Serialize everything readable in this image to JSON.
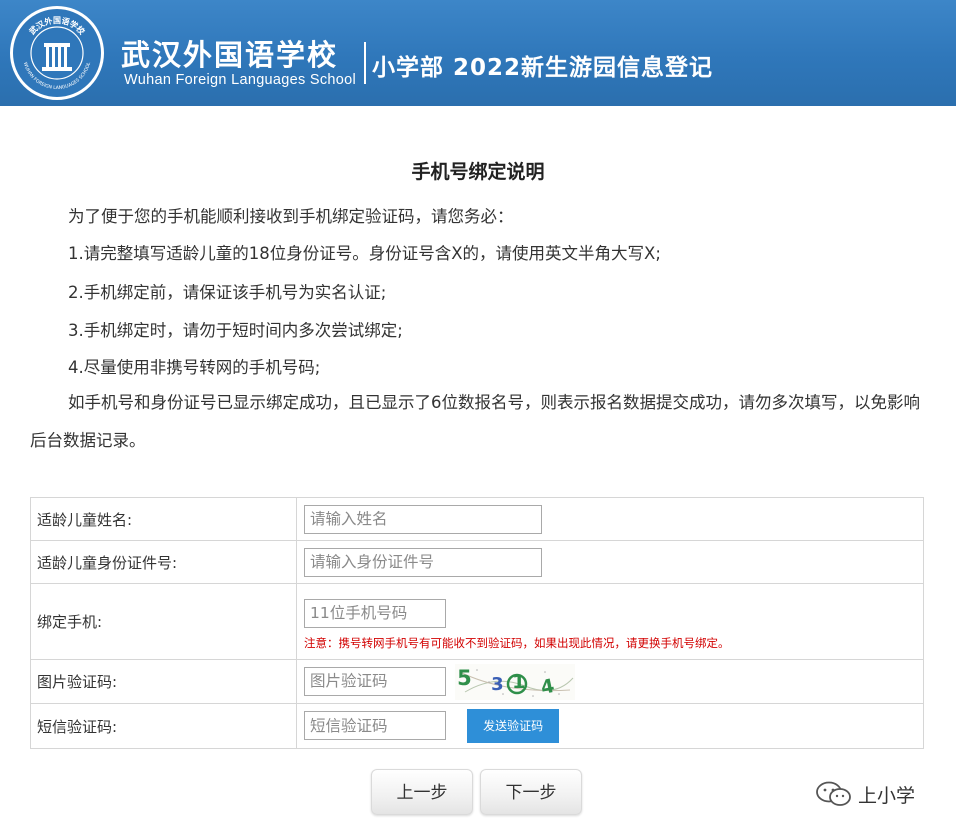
{
  "header": {
    "school_name_cn": "武汉外国语学校",
    "school_name_en": "Wuhan Foreign Languages School",
    "seal_text": "武汉外国语学校 WUHAN FOREIGN LANGUAGES SCHOOL",
    "page_title": "小学部 2022新生游园信息登记"
  },
  "notice": {
    "title": "手机号绑定说明",
    "intro": "为了便于您的手机能顺利接收到手机绑定验证码，请您务必：",
    "items": [
      "1.请完整填写适龄儿童的18位身份证号。身份证号含X的，请使用英文半角大写X;",
      "2.手机绑定前，请保证该手机号为实名认证;",
      "3.手机绑定时，请勿于短时间内多次尝试绑定;",
      "4.尽量使用非携号转网的手机号码;"
    ],
    "closing": "如手机号和身份证号已显示绑定成功，且已显示了6位数报名号，则表示报名数据提交成功，请勿多次填写，以免影响后台数据记录。"
  },
  "form": {
    "child_name": {
      "label": "适龄儿童姓名:",
      "placeholder": "请输入姓名",
      "value": ""
    },
    "child_id": {
      "label": "适龄儿童身份证件号:",
      "placeholder": "请输入身份证件号",
      "value": ""
    },
    "phone": {
      "label": "绑定手机:",
      "placeholder": "11位手机号码",
      "value": "",
      "warning": "注意：携号转网手机号有可能收不到验证码，如果出现此情况，请更换手机号绑定。"
    },
    "image_code": {
      "label": "图片验证码:",
      "placeholder": "图片验证码",
      "value": "",
      "captcha_chars": [
        "5",
        "3",
        "1",
        "4"
      ]
    },
    "sms_code": {
      "label": "短信验证码:",
      "placeholder": "短信验证码",
      "value": "",
      "send_button": "发送验证码"
    }
  },
  "buttons": {
    "prev": "上一步",
    "next": "下一步"
  },
  "watermark": {
    "text": "上小学"
  },
  "colors": {
    "banner": "#2f77ba",
    "warning_text": "#d20000",
    "send_button": "#2e8fd8",
    "captcha_green": "#2f8f4a",
    "captcha_blue": "#3a5fb5"
  }
}
